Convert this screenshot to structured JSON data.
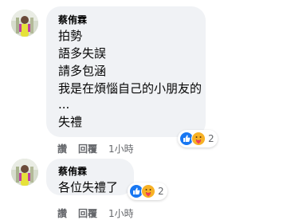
{
  "comments": [
    {
      "author": "蔡侑霖",
      "lines": [
        "拍勢",
        "語多失誤",
        "請多包涵",
        "我是在煩惱自己的小朋友的",
        "...",
        "失禮"
      ],
      "reactions": {
        "icons": [
          "like-icon",
          "care-icon"
        ],
        "count": "2"
      },
      "actions": {
        "like": "讚",
        "reply": "回覆",
        "time": "1小時"
      }
    },
    {
      "author": "蔡侑霖",
      "lines": [
        "各位失禮了"
      ],
      "reactions": {
        "icons": [
          "like-icon",
          "care-icon"
        ],
        "count": "2"
      },
      "actions": {
        "like": "讚",
        "reply": "回覆",
        "time": "1小時"
      }
    }
  ],
  "colors": {
    "bubble": "#f0f2f5",
    "text": "#050505",
    "secondary": "#65676b",
    "like_blue": "#1877f2",
    "care_yellow": "#f7b125"
  }
}
